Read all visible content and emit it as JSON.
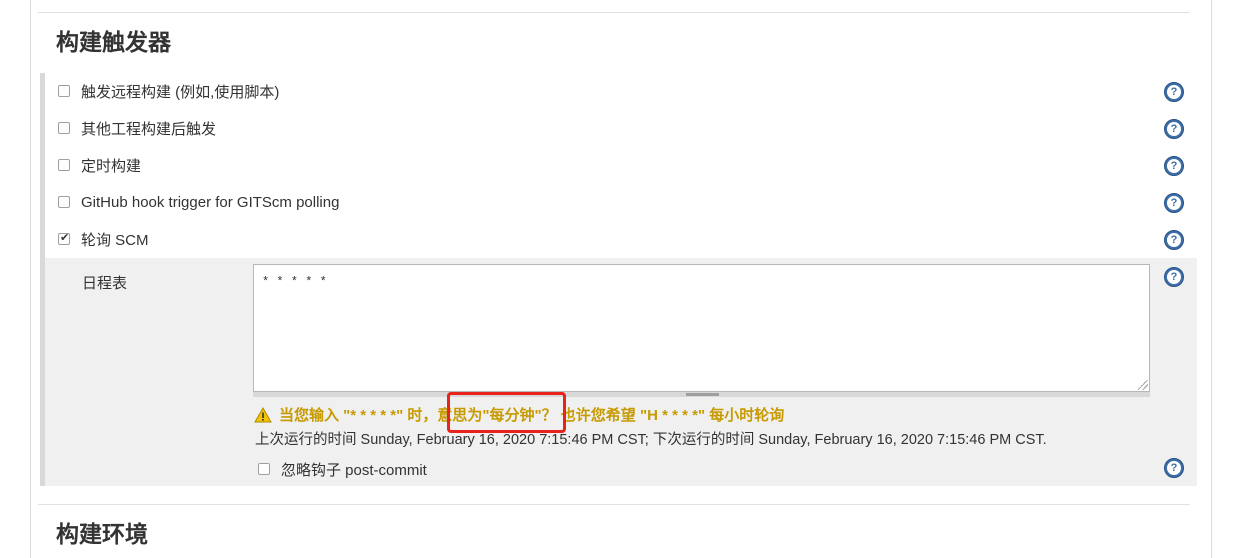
{
  "sections": {
    "build_triggers_title": "构建触发器",
    "build_env_title": "构建环境"
  },
  "triggers": [
    {
      "label": "触发远程构建 (例如,使用脚本)",
      "checked": false
    },
    {
      "label": "其他工程构建后触发",
      "checked": false
    },
    {
      "label": "定时构建",
      "checked": false
    },
    {
      "label": "GitHub hook trigger for GITScm polling",
      "checked": false
    },
    {
      "label": "轮询 SCM",
      "checked": true
    }
  ],
  "poll_scm": {
    "schedule_label": "日程表",
    "schedule_value": "* * * * *",
    "warning": "当您输入 \"* * * * *\" 时，意思为\"每分钟\"？ 也许您希望 \"H * * * *\" 每小时轮询",
    "run_info": "上次运行的时间 Sunday, February 16, 2020 7:15:46 PM CST; 下次运行的时间 Sunday, February 16, 2020 7:15:46 PM CST.",
    "ignore_hook_label": "忽略钩子 post-commit",
    "ignore_hook_checked": false
  },
  "help_glyph": "?",
  "colors": {
    "help_icon": "#3d6ea8",
    "warning_text": "#c79b00",
    "highlight_border": "#e8231c",
    "sub_block_bg": "#f0f0f0"
  },
  "icons": {
    "help": "question-circle-icon",
    "warning": "warning-triangle-icon"
  }
}
